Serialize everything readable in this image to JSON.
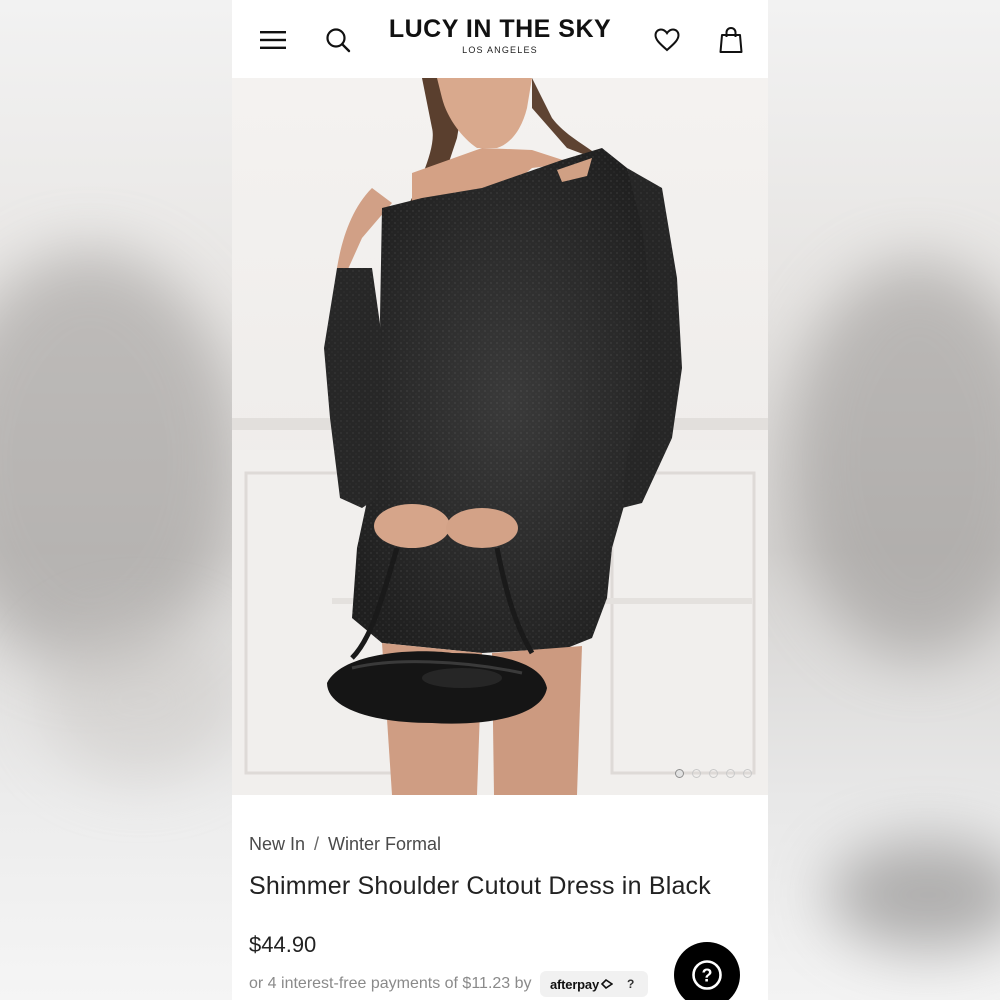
{
  "header": {
    "brand_name": "LUCY IN THE SKY",
    "brand_location": "LOS ANGELES",
    "icons": [
      "menu-icon",
      "search-icon",
      "heart-icon",
      "shopping-bag-icon"
    ]
  },
  "gallery": {
    "slide_count": 5,
    "active_slide": 1
  },
  "breadcrumb": {
    "items": [
      "New In",
      "Winter Formal"
    ],
    "separator": "/"
  },
  "product": {
    "title": "Shimmer Shoulder Cutout Dress in Black",
    "price": "$44.90",
    "installment_text": "or 4 interest-free payments of $11.23 by",
    "afterpay_label": "afterpay",
    "afterpay_info": "?"
  },
  "help_button": {
    "label": "?"
  },
  "colors": {
    "text": "#222222",
    "muted": "#8a8a8a",
    "dress": "#2a2a2a",
    "background": "#ffffff"
  }
}
